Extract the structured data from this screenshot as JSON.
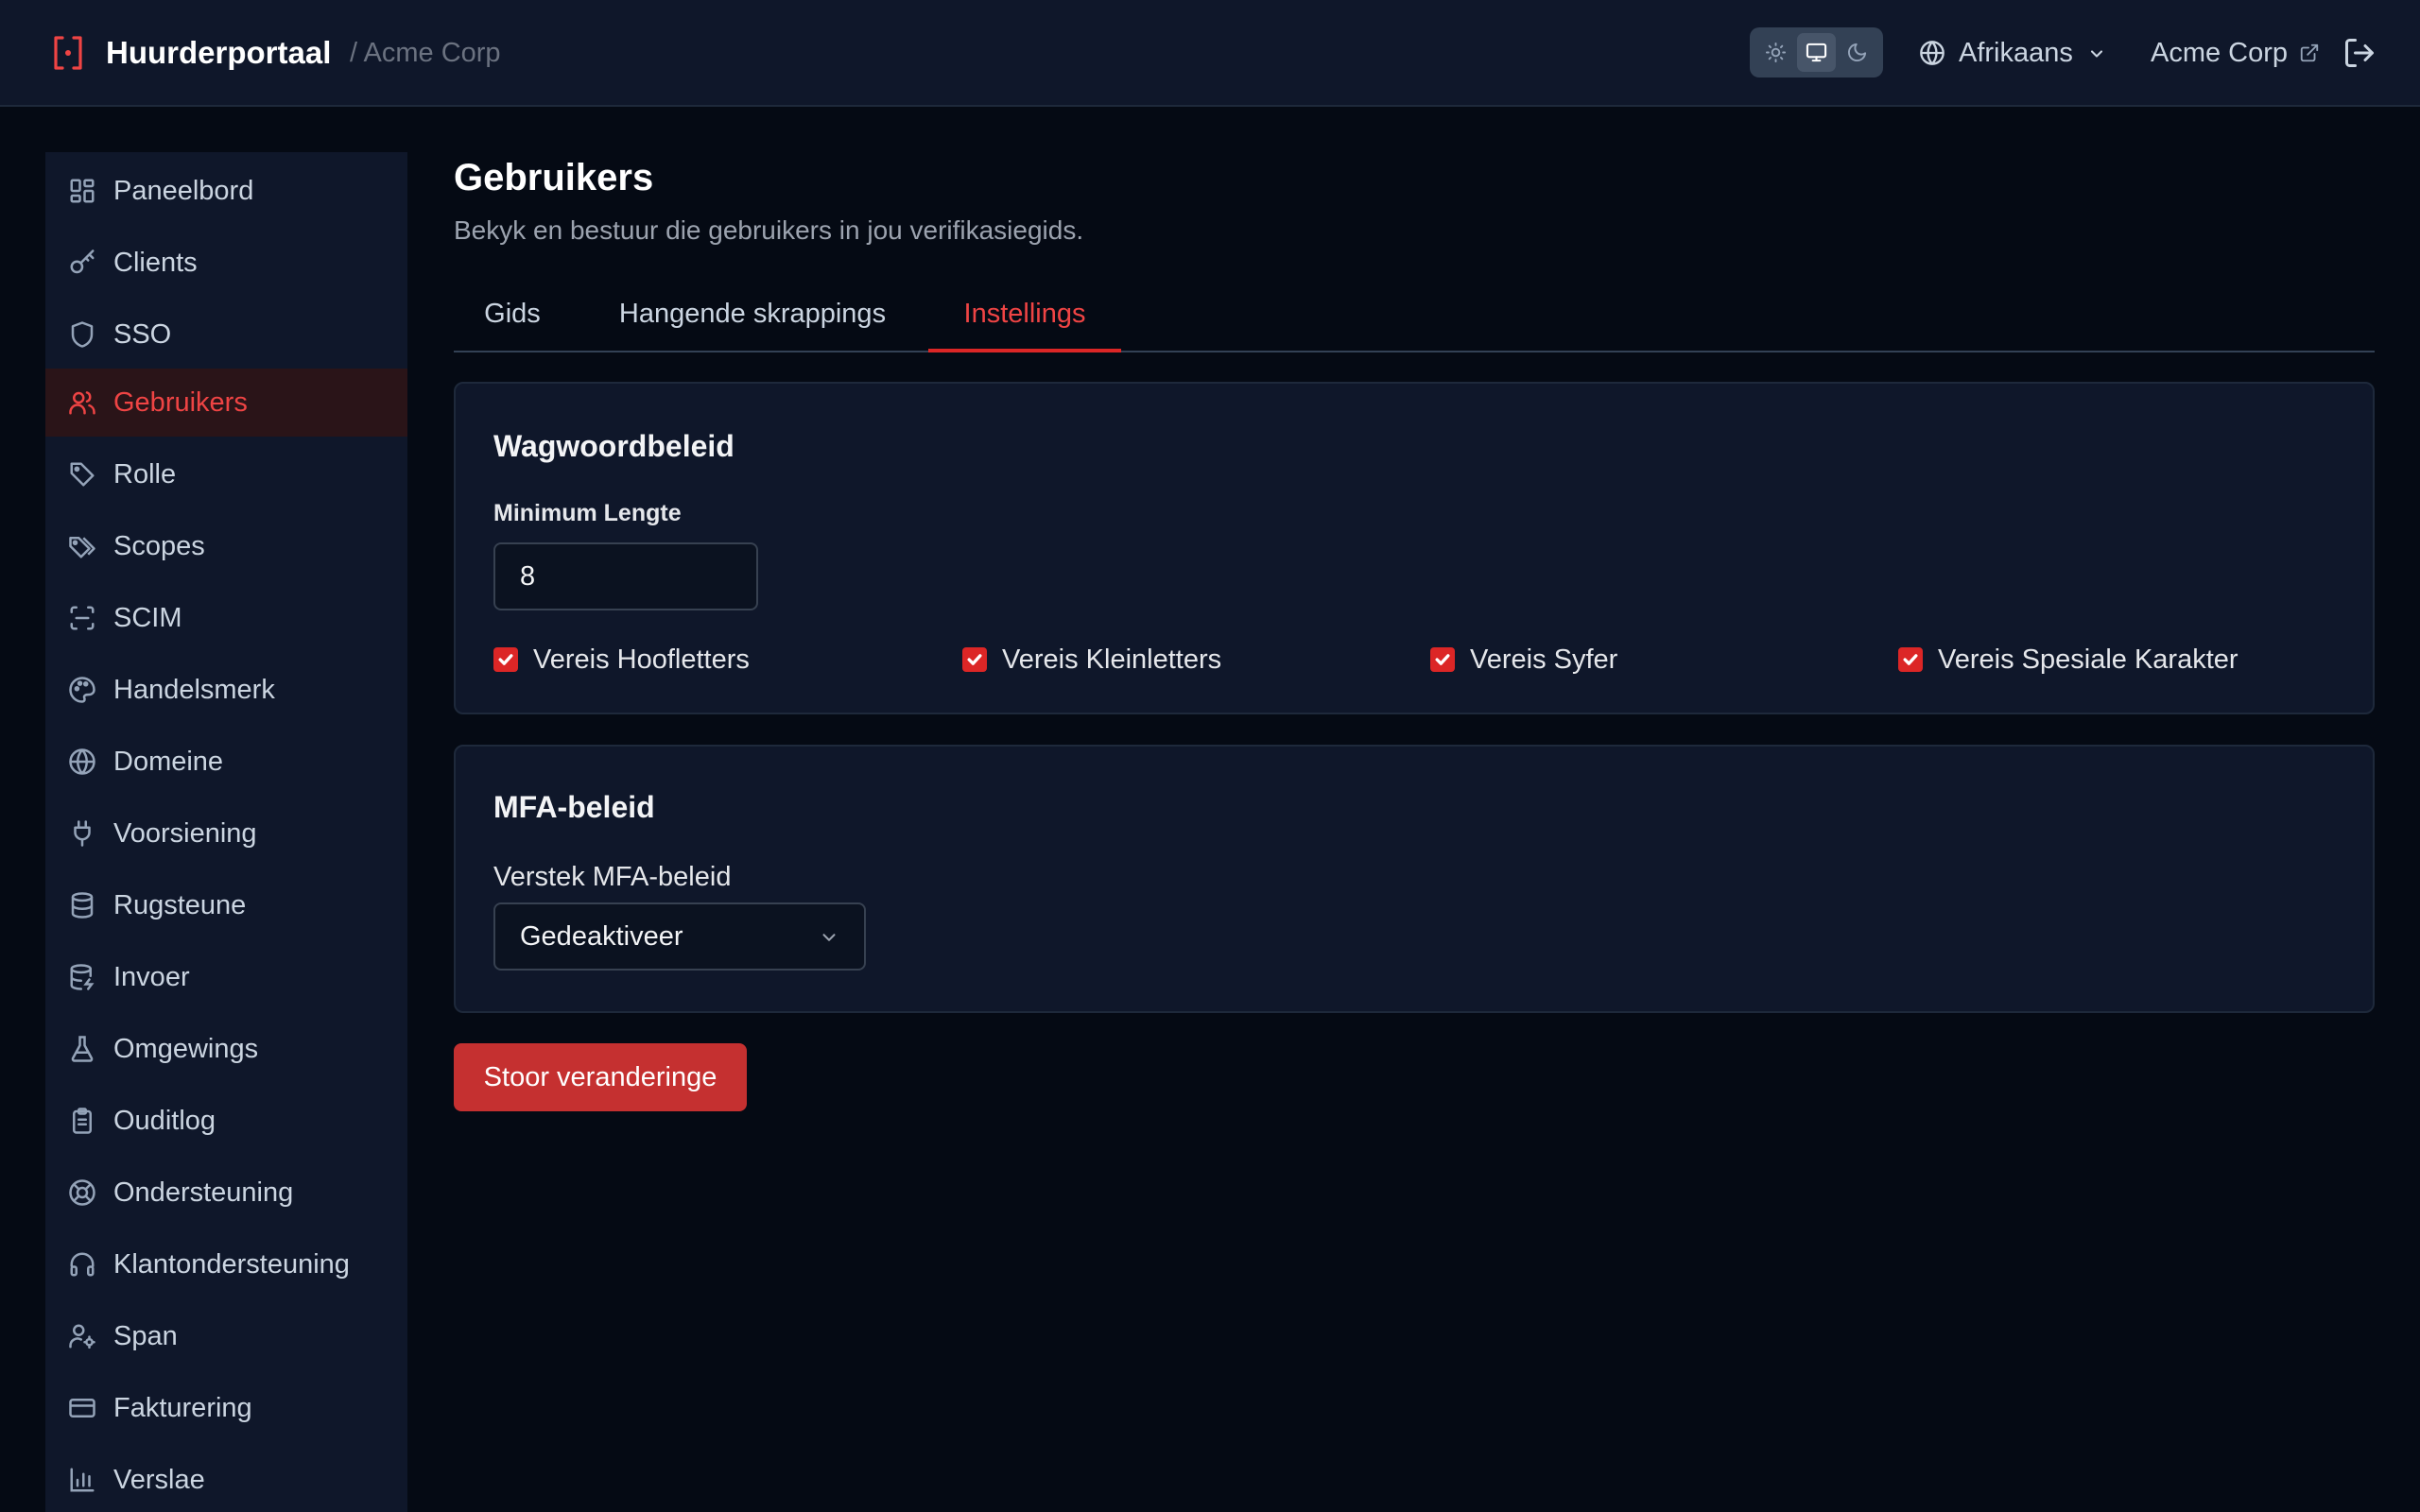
{
  "header": {
    "title": "Huurderportaal",
    "breadcrumb": "/ Acme Corp",
    "theme_options": [
      "light",
      "system",
      "dark"
    ],
    "theme_selected": "system",
    "language": "Afrikaans",
    "organization": "Acme Corp"
  },
  "sidebar": {
    "items": [
      {
        "label": "Paneelbord",
        "icon": "dashboard-icon"
      },
      {
        "label": "Clients",
        "icon": "key-icon"
      },
      {
        "label": "SSO",
        "icon": "shield-icon"
      },
      {
        "label": "Gebruikers",
        "icon": "users-icon",
        "active": true
      },
      {
        "label": "Rolle",
        "icon": "tag-icon"
      },
      {
        "label": "Scopes",
        "icon": "tags-icon"
      },
      {
        "label": "SCIM",
        "icon": "scan-icon"
      },
      {
        "label": "Handelsmerk",
        "icon": "palette-icon"
      },
      {
        "label": "Domeine",
        "icon": "globe-icon"
      },
      {
        "label": "Voorsiening",
        "icon": "plug-icon"
      },
      {
        "label": "Rugsteune",
        "icon": "database-icon"
      },
      {
        "label": "Invoer",
        "icon": "database-import-icon"
      },
      {
        "label": "Omgewings",
        "icon": "flask-icon"
      },
      {
        "label": "Ouditlog",
        "icon": "clipboard-icon"
      },
      {
        "label": "Ondersteuning",
        "icon": "lifebuoy-icon"
      },
      {
        "label": "Klantondersteuning",
        "icon": "headset-icon"
      },
      {
        "label": "Span",
        "icon": "user-cog-icon"
      },
      {
        "label": "Fakturering",
        "icon": "credit-card-icon"
      },
      {
        "label": "Verslae",
        "icon": "bar-chart-icon"
      }
    ]
  },
  "main": {
    "title": "Gebruikers",
    "subtitle": "Bekyk en bestuur die gebruikers in jou verifikasiegids.",
    "tabs": [
      {
        "label": "Gids"
      },
      {
        "label": "Hangende skrappings"
      },
      {
        "label": "Instellings",
        "active": true
      }
    ],
    "password_policy": {
      "title": "Wagwoordbeleid",
      "min_length_label": "Minimum Lengte",
      "min_length_value": "8",
      "checks": [
        {
          "label": "Vereis Hoofletters",
          "checked": true
        },
        {
          "label": "Vereis Kleinletters",
          "checked": true
        },
        {
          "label": "Vereis Syfer",
          "checked": true
        },
        {
          "label": "Vereis Spesiale Karakter",
          "checked": true
        }
      ]
    },
    "mfa_policy": {
      "title": "MFA-beleid",
      "default_label": "Verstek MFA-beleid",
      "default_value": "Gedeaktiveer"
    },
    "save_label": "Stoor veranderinge"
  },
  "colors": {
    "accent": "#dc2626",
    "background": "#050a14",
    "panel": "#0f172a"
  }
}
